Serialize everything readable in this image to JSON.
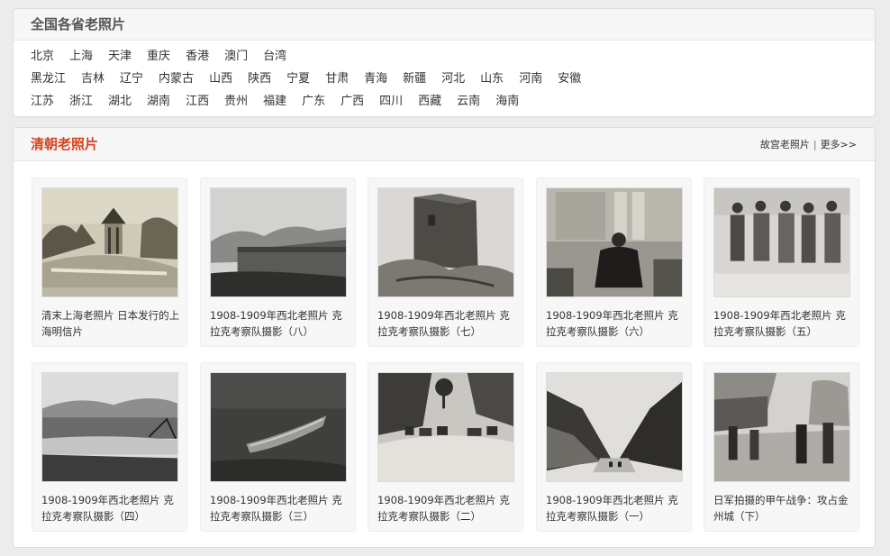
{
  "provinces": {
    "title": "全国各省老照片",
    "rows": [
      [
        "北京",
        "上海",
        "天津",
        "重庆",
        "香港",
        "澳门",
        "台湾"
      ],
      [
        "黑龙江",
        "吉林",
        "辽宁",
        "内蒙古",
        "山西",
        "陕西",
        "宁夏",
        "甘肃",
        "青海",
        "新疆",
        "河北",
        "山东",
        "河南",
        "安徽"
      ],
      [
        "江苏",
        "浙江",
        "湖北",
        "湖南",
        "江西",
        "贵州",
        "福建",
        "广东",
        "广西",
        "四川",
        "西藏",
        "云南",
        "海南"
      ]
    ]
  },
  "qing": {
    "title": "清朝老照片",
    "link_palace": "故宫老照片",
    "separator": "|",
    "link_more": "更多>>",
    "photos": [
      {
        "caption": "清末上海老照片 日本发行的上海明信片",
        "thumb": "pavilion"
      },
      {
        "caption": "1908-1909年西北老照片 克拉克考察队摄影（八）",
        "thumb": "city-wall"
      },
      {
        "caption": "1908-1909年西北老照片 克拉克考察队摄影（七）",
        "thumb": "watchtower"
      },
      {
        "caption": "1908-1909年西北老照片 克拉克考察队摄影（六）",
        "thumb": "official"
      },
      {
        "caption": "1908-1909年西北老照片 克拉克考察队摄影（五）",
        "thumb": "group"
      },
      {
        "caption": "1908-1909年西北老照片 克拉克考察队摄影（四）",
        "thumb": "river-town"
      },
      {
        "caption": "1908-1909年西北老照片 克拉克考察队摄影（三）",
        "thumb": "boat"
      },
      {
        "caption": "1908-1909年西北老照片 克拉克考察队摄影（二）",
        "thumb": "caravan"
      },
      {
        "caption": "1908-1909年西北老照片 克拉克考察队摄影（一）",
        "thumb": "gorge"
      },
      {
        "caption": "日军拍摄的甲午战争：攻占金州城（下）",
        "thumb": "street"
      }
    ]
  }
}
